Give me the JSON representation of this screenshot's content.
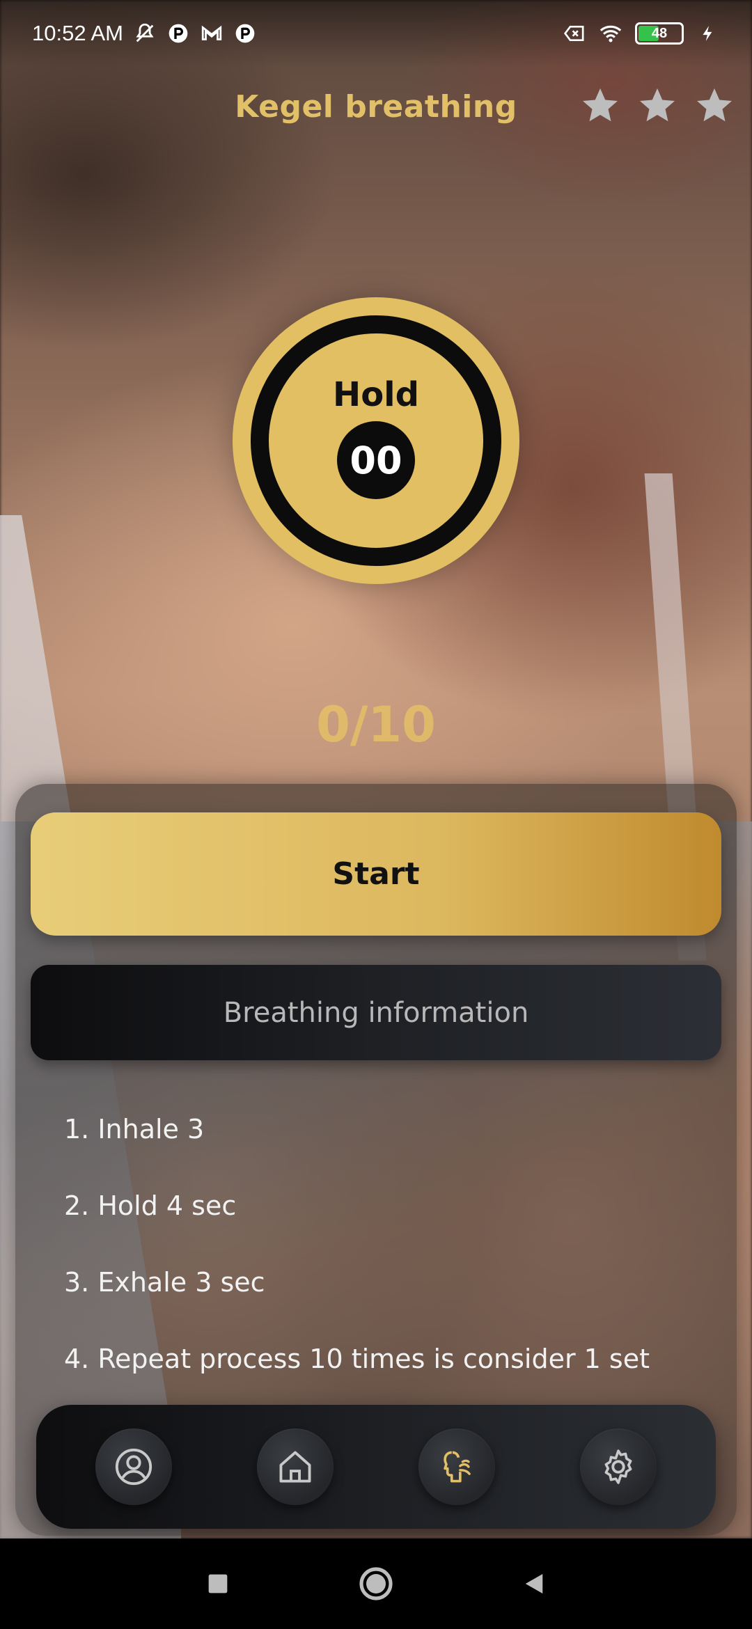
{
  "status_bar": {
    "time": "10:52 AM",
    "battery_level": "48",
    "icons": [
      "mute-icon",
      "notification-app-icon",
      "gmail-icon",
      "notification-app-icon",
      "sim-x-icon",
      "wifi-icon",
      "battery-icon",
      "charging-icon"
    ]
  },
  "header": {
    "title": "Kegel breathing",
    "rating": {
      "filled": 0,
      "total": 3
    }
  },
  "timer": {
    "phase_label": "Hold",
    "count": "00"
  },
  "progress": {
    "text": "0/10",
    "current": 0,
    "total": 10
  },
  "actions": {
    "start_label": "Start",
    "info_label": "Breathing information"
  },
  "steps": [
    "1. Inhale 3",
    "2. Hold 4 sec",
    "3. Exhale 3 sec",
    "4. Repeat process 10 times is consider 1 set"
  ],
  "bottom_nav": {
    "items": [
      {
        "icon": "profile-icon",
        "active": false
      },
      {
        "icon": "home-icon",
        "active": false
      },
      {
        "icon": "breathing-icon",
        "active": true
      },
      {
        "icon": "gear-icon",
        "active": false
      }
    ]
  },
  "colors": {
    "accent_gold": "#e1bf62",
    "active_icon": "#e2c068",
    "inactive_icon": "#c9c9c9"
  }
}
